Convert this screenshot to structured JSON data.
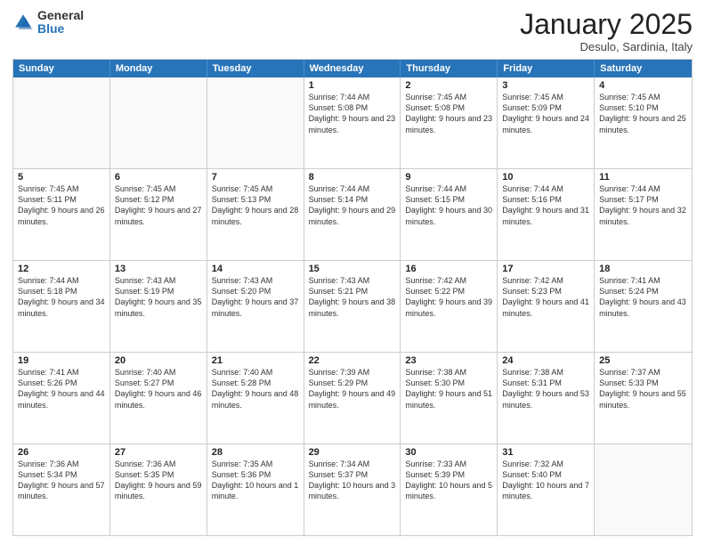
{
  "header": {
    "logo_general": "General",
    "logo_blue": "Blue",
    "month_title": "January 2025",
    "location": "Desulo, Sardinia, Italy"
  },
  "days_of_week": [
    "Sunday",
    "Monday",
    "Tuesday",
    "Wednesday",
    "Thursday",
    "Friday",
    "Saturday"
  ],
  "weeks": [
    [
      {
        "day": "",
        "empty": true
      },
      {
        "day": "",
        "empty": true
      },
      {
        "day": "",
        "empty": true
      },
      {
        "day": "1",
        "sunrise": "7:44 AM",
        "sunset": "5:08 PM",
        "daylight": "9 hours and 23 minutes."
      },
      {
        "day": "2",
        "sunrise": "7:45 AM",
        "sunset": "5:08 PM",
        "daylight": "9 hours and 23 minutes."
      },
      {
        "day": "3",
        "sunrise": "7:45 AM",
        "sunset": "5:09 PM",
        "daylight": "9 hours and 24 minutes."
      },
      {
        "day": "4",
        "sunrise": "7:45 AM",
        "sunset": "5:10 PM",
        "daylight": "9 hours and 25 minutes."
      }
    ],
    [
      {
        "day": "5",
        "sunrise": "7:45 AM",
        "sunset": "5:11 PM",
        "daylight": "9 hours and 26 minutes."
      },
      {
        "day": "6",
        "sunrise": "7:45 AM",
        "sunset": "5:12 PM",
        "daylight": "9 hours and 27 minutes."
      },
      {
        "day": "7",
        "sunrise": "7:45 AM",
        "sunset": "5:13 PM",
        "daylight": "9 hours and 28 minutes."
      },
      {
        "day": "8",
        "sunrise": "7:44 AM",
        "sunset": "5:14 PM",
        "daylight": "9 hours and 29 minutes."
      },
      {
        "day": "9",
        "sunrise": "7:44 AM",
        "sunset": "5:15 PM",
        "daylight": "9 hours and 30 minutes."
      },
      {
        "day": "10",
        "sunrise": "7:44 AM",
        "sunset": "5:16 PM",
        "daylight": "9 hours and 31 minutes."
      },
      {
        "day": "11",
        "sunrise": "7:44 AM",
        "sunset": "5:17 PM",
        "daylight": "9 hours and 32 minutes."
      }
    ],
    [
      {
        "day": "12",
        "sunrise": "7:44 AM",
        "sunset": "5:18 PM",
        "daylight": "9 hours and 34 minutes."
      },
      {
        "day": "13",
        "sunrise": "7:43 AM",
        "sunset": "5:19 PM",
        "daylight": "9 hours and 35 minutes."
      },
      {
        "day": "14",
        "sunrise": "7:43 AM",
        "sunset": "5:20 PM",
        "daylight": "9 hours and 37 minutes."
      },
      {
        "day": "15",
        "sunrise": "7:43 AM",
        "sunset": "5:21 PM",
        "daylight": "9 hours and 38 minutes."
      },
      {
        "day": "16",
        "sunrise": "7:42 AM",
        "sunset": "5:22 PM",
        "daylight": "9 hours and 39 minutes."
      },
      {
        "day": "17",
        "sunrise": "7:42 AM",
        "sunset": "5:23 PM",
        "daylight": "9 hours and 41 minutes."
      },
      {
        "day": "18",
        "sunrise": "7:41 AM",
        "sunset": "5:24 PM",
        "daylight": "9 hours and 43 minutes."
      }
    ],
    [
      {
        "day": "19",
        "sunrise": "7:41 AM",
        "sunset": "5:26 PM",
        "daylight": "9 hours and 44 minutes."
      },
      {
        "day": "20",
        "sunrise": "7:40 AM",
        "sunset": "5:27 PM",
        "daylight": "9 hours and 46 minutes."
      },
      {
        "day": "21",
        "sunrise": "7:40 AM",
        "sunset": "5:28 PM",
        "daylight": "9 hours and 48 minutes."
      },
      {
        "day": "22",
        "sunrise": "7:39 AM",
        "sunset": "5:29 PM",
        "daylight": "9 hours and 49 minutes."
      },
      {
        "day": "23",
        "sunrise": "7:38 AM",
        "sunset": "5:30 PM",
        "daylight": "9 hours and 51 minutes."
      },
      {
        "day": "24",
        "sunrise": "7:38 AM",
        "sunset": "5:31 PM",
        "daylight": "9 hours and 53 minutes."
      },
      {
        "day": "25",
        "sunrise": "7:37 AM",
        "sunset": "5:33 PM",
        "daylight": "9 hours and 55 minutes."
      }
    ],
    [
      {
        "day": "26",
        "sunrise": "7:36 AM",
        "sunset": "5:34 PM",
        "daylight": "9 hours and 57 minutes."
      },
      {
        "day": "27",
        "sunrise": "7:36 AM",
        "sunset": "5:35 PM",
        "daylight": "9 hours and 59 minutes."
      },
      {
        "day": "28",
        "sunrise": "7:35 AM",
        "sunset": "5:36 PM",
        "daylight": "10 hours and 1 minute."
      },
      {
        "day": "29",
        "sunrise": "7:34 AM",
        "sunset": "5:37 PM",
        "daylight": "10 hours and 3 minutes."
      },
      {
        "day": "30",
        "sunrise": "7:33 AM",
        "sunset": "5:39 PM",
        "daylight": "10 hours and 5 minutes."
      },
      {
        "day": "31",
        "sunrise": "7:32 AM",
        "sunset": "5:40 PM",
        "daylight": "10 hours and 7 minutes."
      },
      {
        "day": "",
        "empty": true
      }
    ]
  ]
}
